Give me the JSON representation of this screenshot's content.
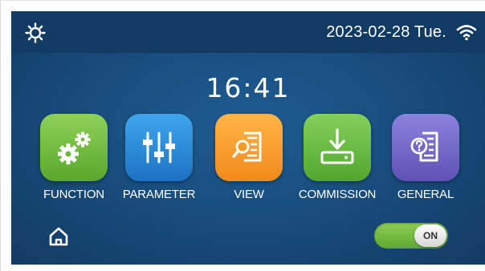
{
  "status_bar": {
    "left_icon": "sun-icon",
    "date": "2023-02-28 Tue.",
    "right_icon": "wifi-icon"
  },
  "clock": {
    "time": "16:41"
  },
  "menu": {
    "items": [
      {
        "label": "FUNCTION",
        "icon": "gears-icon",
        "color": "#6dbb3c"
      },
      {
        "label": "PARAMETER",
        "icon": "sliders-icon",
        "color": "#2a8ad8"
      },
      {
        "label": "VIEW",
        "icon": "document-search-icon",
        "color": "#f79a26"
      },
      {
        "label": "COMMISSION",
        "icon": "download-icon",
        "color": "#62b83a"
      },
      {
        "label": "GENERAL",
        "icon": "document-help-icon",
        "color": "#7268c9"
      }
    ]
  },
  "footer": {
    "home_icon": "home-icon",
    "toggle_label": "ON",
    "toggle_state": "on"
  },
  "colors": {
    "background": "#174a7a",
    "status_bar": "#103b63",
    "toggle_on": "#6fb83f"
  }
}
